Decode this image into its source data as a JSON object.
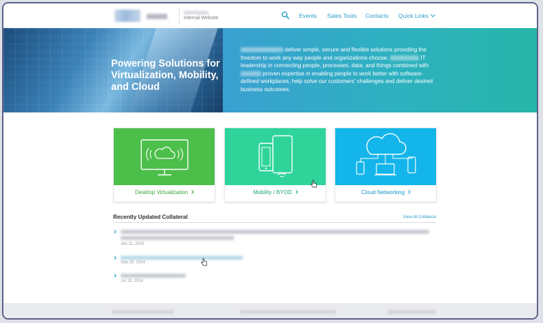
{
  "header": {
    "site_tag": "Internal Website",
    "search_icon": "search-icon",
    "nav": [
      {
        "label": "Events"
      },
      {
        "label": "Sales Tools"
      },
      {
        "label": "Contacts"
      },
      {
        "label": "Quick Links"
      }
    ],
    "accent": "#2a9dc9"
  },
  "hero": {
    "title": "Powering Solutions for Virtualization, Mobility, and Cloud",
    "text": {
      "p1": "deliver simple, secure and flexible solutions providing the freedom to work any way people and organizations choose.",
      "p2": "IT leadership in connecting people, processes, data, and things combined with",
      "p3": "proven expertise in enabling people to work better with software-defined workplaces, help solve our customers' challenges and deliver desired business outcomes."
    },
    "panel_color": "#2eb1c0"
  },
  "cards": [
    {
      "label": "Desktop Virtualization",
      "icon": "monitor-cloud-icon",
      "color": "#4cbe4a"
    },
    {
      "label": "Mobility / BYOD",
      "icon": "mobile-devices-icon",
      "color": "#2fd49a"
    },
    {
      "label": "Cloud Networking",
      "icon": "cloud-network-icon",
      "color": "#13b5ea"
    }
  ],
  "collateral": {
    "title": "Recently Updated Collateral",
    "view_all": "View All Collateral",
    "items": [
      {
        "date": "Jan 11, 2015"
      },
      {
        "date": "Sep 29, 2014"
      },
      {
        "date": "Jul 18, 2014"
      }
    ]
  }
}
